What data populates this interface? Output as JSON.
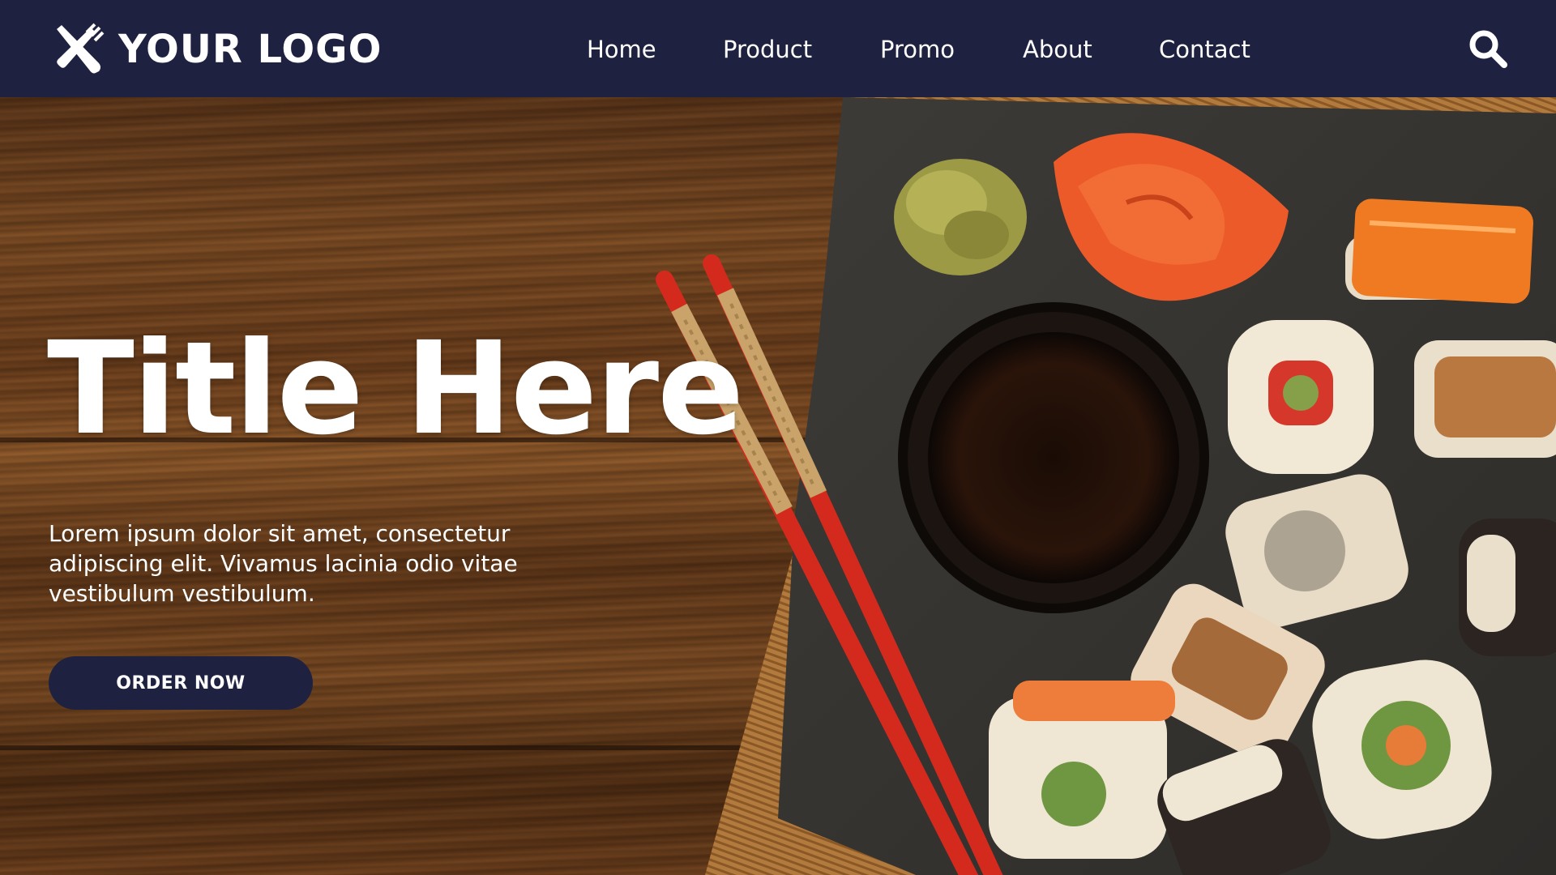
{
  "header": {
    "logo_text": "YOUR LOGO",
    "logo_icon": "fork-knife-icon",
    "nav": [
      {
        "label": "Home"
      },
      {
        "label": "Product"
      },
      {
        "label": "Promo"
      },
      {
        "label": "About"
      },
      {
        "label": "Contact"
      }
    ],
    "search_icon": "search-icon"
  },
  "hero": {
    "title": "Title Here",
    "description": "Lorem ipsum dolor sit amet, consectetur adipiscing elit. Vivamus lacinia odio vitae vestibulum vestibulum.",
    "cta_label": "ORDER NOW"
  },
  "colors": {
    "navbar_bg": "#1e2240",
    "button_bg": "#1e2240",
    "text": "#ffffff",
    "chopstick_red": "#d42a1e"
  }
}
